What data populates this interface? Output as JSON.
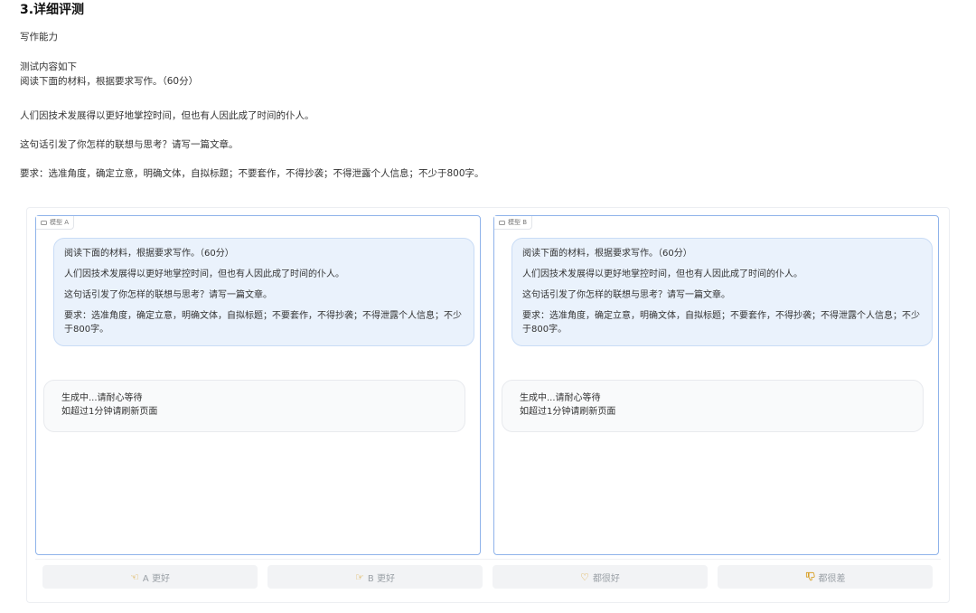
{
  "section": {
    "heading": "3.详细评测",
    "skill": "写作能力",
    "intro": "测试内容如下",
    "task_title": "阅读下面的材料，根据要求写作。（60分）",
    "material_1": "人们因技术发展得以更好地掌控时间，但也有人因此成了时间的仆人。",
    "material_2": "这句话引发了你怎样的联想与思考？请写一篇文章。",
    "material_3": "要求：选准角度，确定立意，明确文体，自拟标题；不要套作，不得抄袭；不得泄露个人信息；不少于800字。"
  },
  "panels": [
    {
      "tag": "模型 A",
      "prompt": [
        "阅读下面的材料，根据要求写作。（60分）",
        "人们因技术发展得以更好地掌控时间，但也有人因此成了时间的仆人。",
        "这句话引发了你怎样的联想与思考？请写一篇文章。",
        "要求：选准角度，确定立意，明确文体，自拟标题；不要套作，不得抄袭；不得泄露个人信息；不少于800字。"
      ],
      "status_1": "生成中...请耐心等待",
      "status_2": "如超过1分钟请刷新页面"
    },
    {
      "tag": "模型 B",
      "prompt": [
        "阅读下面的材料，根据要求写作。（60分）",
        "人们因技术发展得以更好地掌控时间，但也有人因此成了时间的仆人。",
        "这句话引发了你怎样的联想与思考？请写一篇文章。",
        "要求：选准角度，确定立意，明确文体，自拟标题；不要套作，不得抄袭；不得泄露个人信息；不少于800字。"
      ],
      "status_1": "生成中...请耐心等待",
      "status_2": "如超过1分钟请刷新页面"
    }
  ],
  "votes": [
    {
      "label": "A 更好",
      "icon": "hand-point-left-icon"
    },
    {
      "label": "B 更好",
      "icon": "hand-point-right-icon"
    },
    {
      "label": "都很好",
      "icon": "heart-icon"
    },
    {
      "label": "都很差",
      "icon": "thumbs-down-icon"
    }
  ],
  "colors": {
    "panel_border": "#8fb3ea",
    "user_bubble": "#eaf2fc",
    "vote_bg": "#f2f3f5",
    "icon_accent": "#d9a22b"
  }
}
